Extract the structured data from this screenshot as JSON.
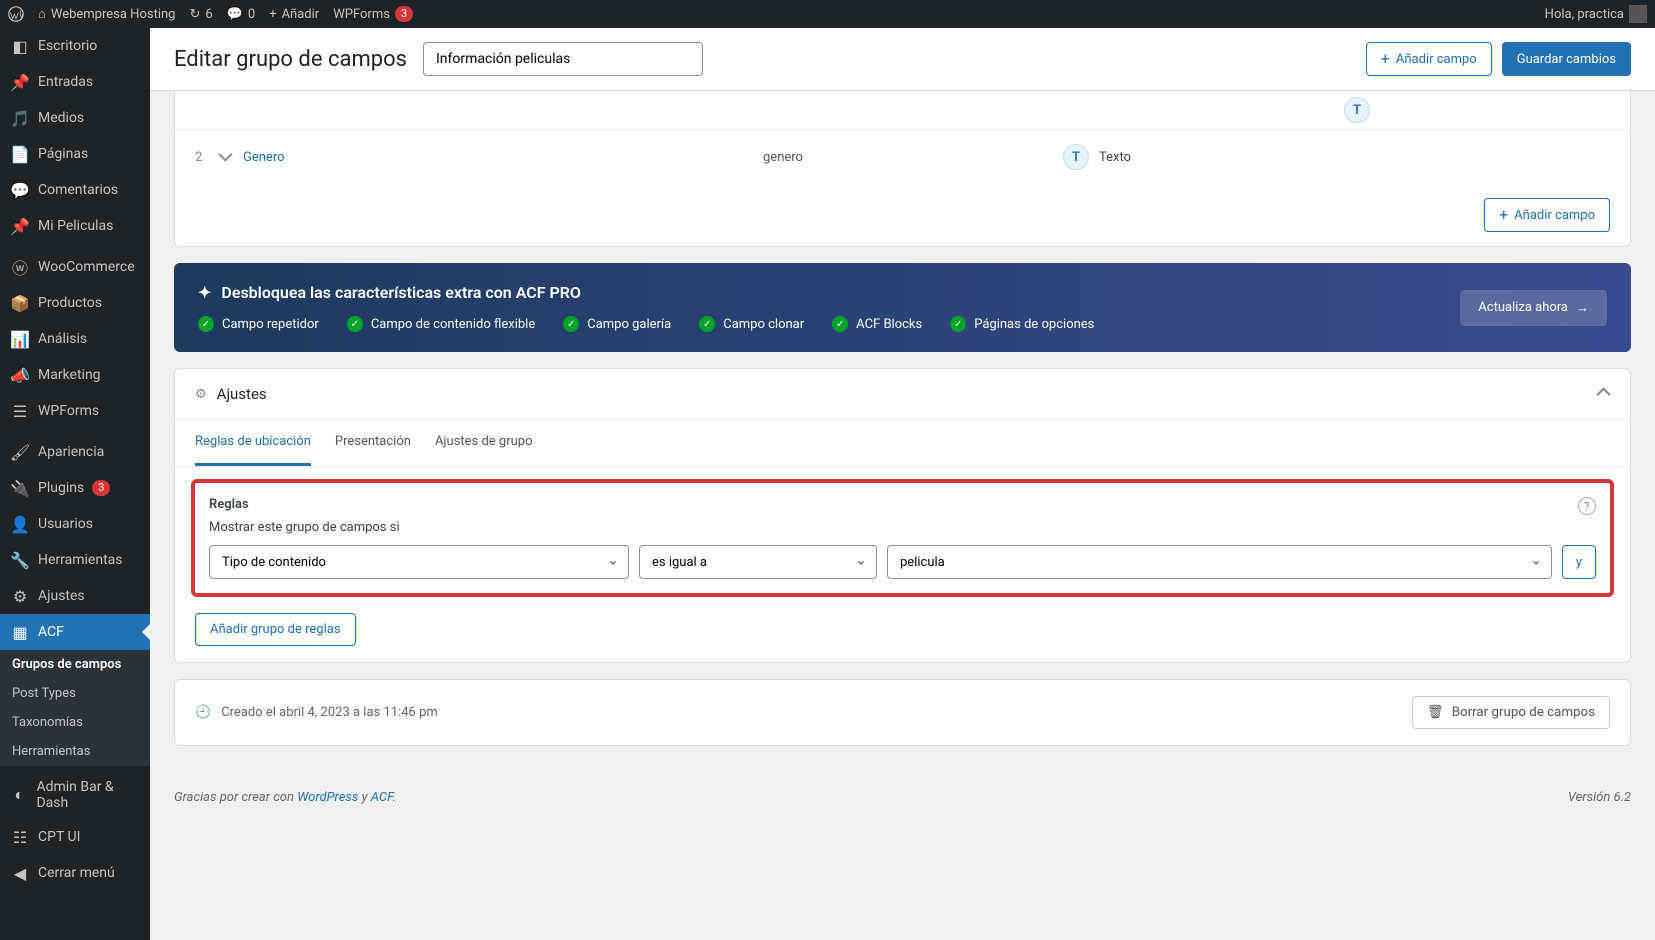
{
  "toolbar": {
    "site_name": "Webempresa Hosting",
    "updates_count": "6",
    "comments_count": "0",
    "add_new": "Añadir",
    "wpforms": "WPForms",
    "wpforms_count": "3",
    "greeting": "Hola, practica"
  },
  "sidebar": {
    "items": [
      {
        "label": "Escritorio",
        "icon": "dashboard"
      },
      {
        "label": "Entradas",
        "icon": "pin"
      },
      {
        "label": "Medios",
        "icon": "media"
      },
      {
        "label": "Páginas",
        "icon": "page"
      },
      {
        "label": "Comentarios",
        "icon": "comment"
      },
      {
        "label": "Mi Peliculas",
        "icon": "pin"
      }
    ],
    "items2": [
      {
        "label": "WooCommerce",
        "icon": "woo"
      },
      {
        "label": "Productos",
        "icon": "product"
      },
      {
        "label": "Análisis",
        "icon": "analytics"
      },
      {
        "label": "Marketing",
        "icon": "megaphone"
      },
      {
        "label": "WPForms",
        "icon": "form"
      }
    ],
    "items3": [
      {
        "label": "Apariencia",
        "icon": "brush"
      },
      {
        "label": "Plugins",
        "icon": "plug",
        "badge": "3"
      },
      {
        "label": "Usuarios",
        "icon": "user"
      },
      {
        "label": "Herramientas",
        "icon": "wrench"
      },
      {
        "label": "Ajustes",
        "icon": "sliders"
      },
      {
        "label": "ACF",
        "icon": "acf",
        "active": true
      }
    ],
    "acf_sub": [
      {
        "label": "Grupos de campos",
        "active": true
      },
      {
        "label": "Post Types"
      },
      {
        "label": "Taxonomías"
      },
      {
        "label": "Herramientas"
      }
    ],
    "items4": [
      {
        "label": "Admin Bar & Dash",
        "icon": "gauge"
      },
      {
        "label": "CPT UI",
        "icon": "cpt"
      },
      {
        "label": "Cerrar menú",
        "icon": "collapse"
      }
    ]
  },
  "header": {
    "title": "Editar grupo de campos",
    "input_value": "Información peliculas",
    "add_field": "Añadir campo",
    "save": "Guardar cambios"
  },
  "fields": [
    {
      "order": "2",
      "name": "Genero",
      "slug": "genero",
      "type_badge": "T",
      "type_label": "Texto"
    }
  ],
  "panel_footer": {
    "add_field": "Añadir campo"
  },
  "promo": {
    "title": "Desbloquea las características extra con ACF PRO",
    "features": [
      "Campo repetidor",
      "Campo de contenido flexible",
      "Campo galería",
      "Campo clonar",
      "ACF Blocks",
      "Páginas de opciones"
    ],
    "cta": "Actualiza ahora"
  },
  "settings": {
    "title": "Ajustes",
    "tabs": [
      "Reglas de ubicación",
      "Presentación",
      "Ajustes de grupo"
    ],
    "rules_label": "Reglas",
    "rules_desc": "Mostrar este grupo de campos si",
    "param": "Tipo de contenido",
    "operator": "es igual a",
    "value": "pelicula",
    "and": "y",
    "add_group": "Añadir grupo de reglas"
  },
  "meta": {
    "created": "Creado el abril 4, 2023 a las 11:46 pm",
    "delete": "Borrar grupo de campos"
  },
  "footer": {
    "thanks_pre": "Gracias por crear con ",
    "wp": "WordPress",
    "and": " y ",
    "acf": "ACF",
    "version": "Versión 6.2"
  }
}
